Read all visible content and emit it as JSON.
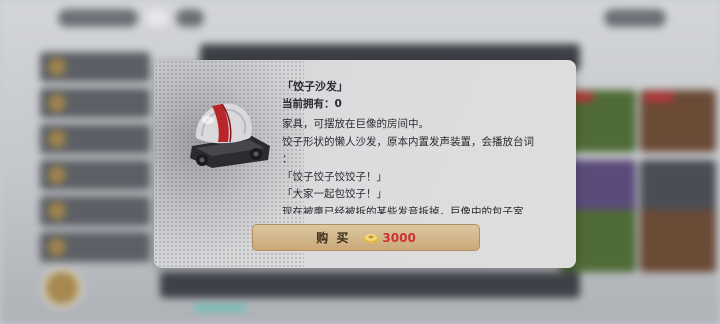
{
  "dialog": {
    "title": "「饺子沙发」",
    "owned_label": "当前拥有：",
    "owned_count": "0",
    "description_lines": [
      "家具，可摆放在巨像的房间中。",
      "饺子形状的懒人沙发，原本内置发声装置，会播放台词",
      "：",
      "「饺子饺子饺饺子！」",
      "「大家一起包饺子！」",
      "现在被鹰已经被拆的某些发音拆掉，巨像中的包子室"
    ],
    "item_icon": "dumpling-sofa-icon",
    "buy_button": {
      "label": "购 买",
      "currency_icon": "coin-icon",
      "price": "3000",
      "price_color": "#d03030"
    }
  },
  "colors": {
    "button_fill": "#caa87a",
    "dialog_bg": "#dcdcde",
    "text": "#2a2b2e"
  }
}
